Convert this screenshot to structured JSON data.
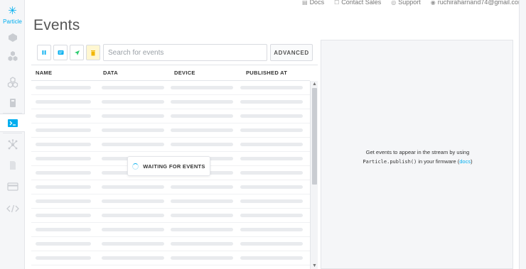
{
  "topbar": {
    "docs": "Docs",
    "contact_sales": "Contact Sales",
    "support": "Support",
    "user_email": "ruchiraharnand74@gmail.com"
  },
  "logo": {
    "text": "Particle"
  },
  "sidebar": {
    "items": [
      {
        "icon": "device-icon"
      },
      {
        "icon": "products-icon"
      },
      {
        "icon": "integrations-icon"
      },
      {
        "icon": "sim-cards-icon"
      },
      {
        "icon": "console-icon"
      },
      {
        "icon": "mesh-network-icon"
      },
      {
        "icon": "sim-icon"
      },
      {
        "icon": "billing-card-icon"
      },
      {
        "icon": "code-icon"
      }
    ]
  },
  "page": {
    "title": "Events"
  },
  "toolbar": {
    "buttons": [
      {
        "icon": "pause-icon"
      },
      {
        "icon": "message-icon"
      },
      {
        "icon": "send-icon"
      },
      {
        "icon": "clear-icon"
      }
    ],
    "search_placeholder": "Search for events",
    "advanced_label": "ADVANCED"
  },
  "table": {
    "columns": [
      "NAME",
      "DATA",
      "DEVICE",
      "PUBLISHED AT"
    ],
    "placeholder_rows": 13
  },
  "waiting": {
    "text": "WAITING FOR EVENTS"
  },
  "panel": {
    "line1": "Get events to appear in the stream by using",
    "code": "Particle.publish()",
    "line2": " in your firmware (",
    "link": "docs",
    "line2_end": ")"
  },
  "colors": {
    "accent": "#00aeef",
    "skeleton": "#e9ebee",
    "panel_bg": "#f5f6f8"
  }
}
